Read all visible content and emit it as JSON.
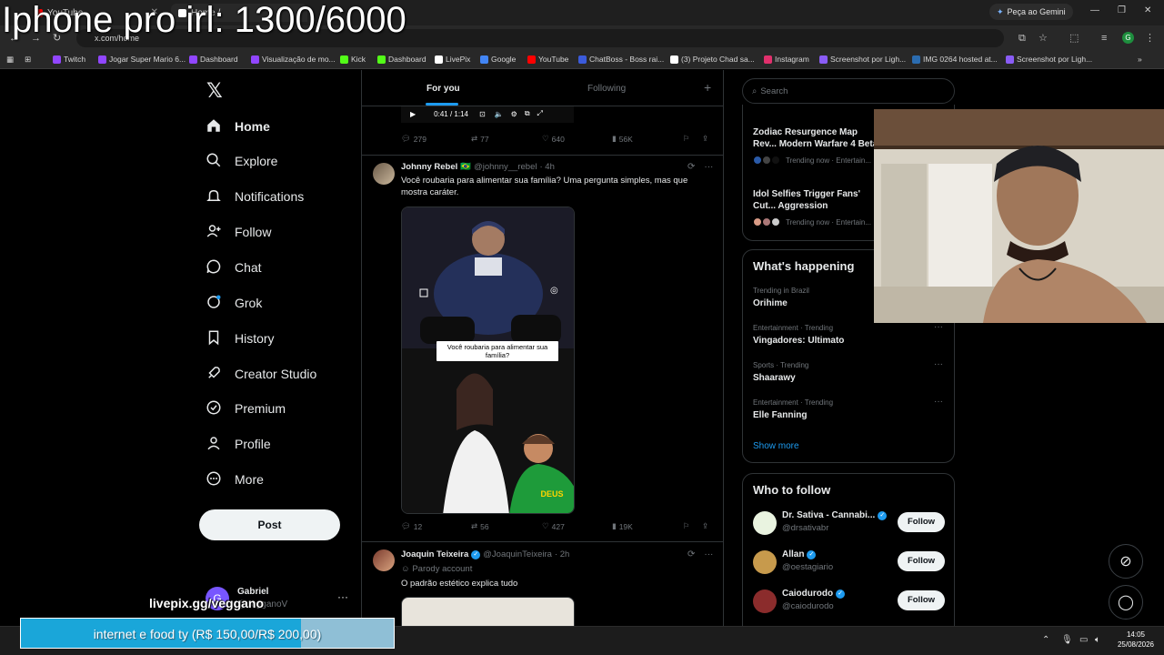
{
  "overlay": {
    "title": "Iphone pro irl: 1300/6000",
    "livepix": "livepix.gg/veggano",
    "goal_text": "internet e food ty (R$ 150,00/R$ 200,00)",
    "goal_progress": 0.75
  },
  "browser": {
    "tabs": [
      {
        "label": "YouTube",
        "color": "#ff0000"
      },
      {
        "label": "Home /",
        "color": "#ffffff"
      }
    ],
    "gemini_label": "Peça ao Gemini",
    "url": "x.com/home",
    "profile_initial": "G",
    "bookmarks": [
      {
        "label": "Twitch",
        "color": "#9146ff"
      },
      {
        "label": "Jogar Super Mario 6...",
        "color": "#9146ff"
      },
      {
        "label": "Dashboard",
        "color": "#9146ff"
      },
      {
        "label": "Visualização de mo...",
        "color": "#9146ff"
      },
      {
        "label": "Kick",
        "color": "#53fc18"
      },
      {
        "label": "Dashboard",
        "color": "#53fc18"
      },
      {
        "label": "LivePix",
        "color": "#ffffff"
      },
      {
        "label": "Google",
        "color": "#4285f4"
      },
      {
        "label": "YouTube",
        "color": "#ff0000"
      },
      {
        "label": "ChatBoss - Boss rai...",
        "color": "#3b5bdb"
      },
      {
        "label": "(3) Projeto Chad sa...",
        "color": "#ffffff"
      },
      {
        "label": "Instagram",
        "color": "#e1306c"
      },
      {
        "label": "Screenshot por Ligh...",
        "color": "#8a5cf6"
      },
      {
        "label": "IMG 0264 hosted at...",
        "color": "#2b6cb0"
      },
      {
        "label": "Screenshot por Ligh...",
        "color": "#8a5cf6"
      }
    ]
  },
  "nav": {
    "items": [
      {
        "label": "Home",
        "icon": "home-icon"
      },
      {
        "label": "Explore",
        "icon": "search-icon"
      },
      {
        "label": "Notifications",
        "icon": "bell-icon"
      },
      {
        "label": "Follow",
        "icon": "person-add-icon"
      },
      {
        "label": "Chat",
        "icon": "chat-icon"
      },
      {
        "label": "Grok",
        "icon": "grok-icon"
      },
      {
        "label": "History",
        "icon": "bookmark-icon"
      },
      {
        "label": "Creator Studio",
        "icon": "rocket-icon"
      },
      {
        "label": "Premium",
        "icon": "verified-icon"
      },
      {
        "label": "Profile",
        "icon": "person-icon"
      },
      {
        "label": "More",
        "icon": "more-icon"
      }
    ],
    "post_label": "Post",
    "account": {
      "name": "Gabriel",
      "handle": "@vegganoV",
      "initial": "G"
    }
  },
  "feed": {
    "tabs": {
      "for_you": "For you",
      "following": "Following"
    },
    "video": {
      "time": "0:41 / 1:14"
    },
    "tweets": [
      {
        "stats": {
          "replies": "279",
          "reposts": "77",
          "likes": "640",
          "views": "56K"
        }
      },
      {
        "name": "Johnny Rebel",
        "flag": "🇧🇷",
        "handle": "@johnny__rebel",
        "time": "· 4h",
        "text": "Você roubaria para alimentar sua família? Uma pergunta simples, mas que mostra caráter.",
        "caption": "Você roubaria para alimentar sua família?",
        "stats": {
          "replies": "12",
          "reposts": "56",
          "likes": "427",
          "views": "19K"
        }
      },
      {
        "name": "Joaquin Teixeira",
        "handle": "@JoaquinTeixeira",
        "time": "· 2h",
        "label": "Parody account",
        "text": "O padrão estético explica tudo"
      }
    ]
  },
  "right": {
    "search_placeholder": "Search",
    "news": [
      {
        "title": "Zodiac Resurgence Map Rev... Modern Warfare 4 Beta",
        "meta": "Trending now · Entertain..."
      },
      {
        "title": "Idol Selfies Trigger Fans' Cut... Aggression",
        "meta": "Trending now · Entertain..."
      }
    ],
    "happening_title": "What's happening",
    "trends": [
      {
        "meta": "Trending in Brazil",
        "name": "Orihime"
      },
      {
        "meta": "Entertainment · Trending",
        "name": "Vingadores: Ultimato"
      },
      {
        "meta": "Sports · Trending",
        "name": "Shaarawy"
      },
      {
        "meta": "Entertainment · Trending",
        "name": "Elle Fanning"
      }
    ],
    "show_more": "Show more",
    "who_to_follow_title": "Who to follow",
    "who_to_follow": [
      {
        "name": "Dr. Sativa - Cannabi...",
        "handle": "@drsativabr",
        "follow": "Follow",
        "color": "#e9f3e0"
      },
      {
        "name": "Allan",
        "handle": "@oestagiario",
        "follow": "Follow",
        "color": "#c79a4c"
      },
      {
        "name": "Caiodurodo",
        "handle": "@caiodurodo",
        "follow": "Follow",
        "color": "#8b2c2c"
      }
    ]
  },
  "taskbar": {
    "time": "14:05",
    "date": "25/08/2026"
  }
}
